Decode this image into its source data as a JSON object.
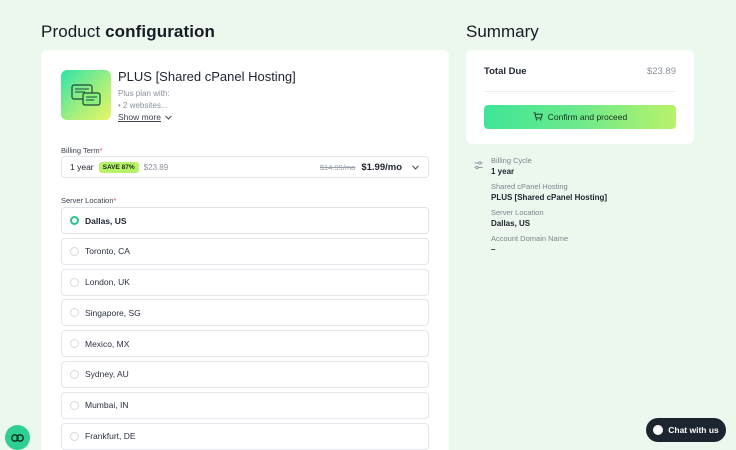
{
  "header": {
    "title_prefix": "Product",
    "title_bold": "configuration",
    "summary_title": "Summary"
  },
  "product": {
    "name": "PLUS [Shared cPanel Hosting]",
    "desc_line1": "Plus plan with:",
    "desc_line2": "• 2 websites...",
    "show_more_label": "Show more",
    "image_icon": "hosting-server-icon"
  },
  "billing": {
    "label": "Billing Term",
    "required": "*",
    "term": "1 year",
    "save_badge": "SAVE 87%",
    "term_total": "$23.89",
    "old_price": "$14.99/mo",
    "new_price": "$1.99/mo"
  },
  "location": {
    "label": "Server Location",
    "required": "*",
    "options": [
      {
        "label": "Dallas, US",
        "selected": true
      },
      {
        "label": "Toronto, CA",
        "selected": false
      },
      {
        "label": "London, UK",
        "selected": false
      },
      {
        "label": "Singapore, SG",
        "selected": false
      },
      {
        "label": "Mexico, MX",
        "selected": false
      },
      {
        "label": "Sydney, AU",
        "selected": false
      },
      {
        "label": "Mumbai, IN",
        "selected": false
      },
      {
        "label": "Frankfurt, DE",
        "selected": false
      }
    ]
  },
  "summary": {
    "total_label": "Total Due",
    "total_value": "$23.89",
    "confirm_label": "Confirm and proceed",
    "details": [
      {
        "label": "Billing Cycle",
        "value": "1 year"
      },
      {
        "label": "Shared cPanel Hosting",
        "value": "PLUS [Shared cPanel Hosting]"
      },
      {
        "label": "Server Location",
        "value": "Dallas, US"
      },
      {
        "label": "Account Domain Name",
        "value": "–"
      }
    ]
  },
  "chat": {
    "label": "Chat with us"
  },
  "colors": {
    "accent": "#27c48a",
    "badge": "#b6f26a",
    "background": "#eaf8ed"
  }
}
